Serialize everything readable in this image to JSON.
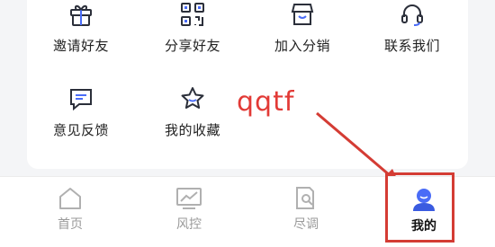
{
  "grid": {
    "items": [
      {
        "label": "邀请好友",
        "icon": "gift-icon"
      },
      {
        "label": "分享好友",
        "icon": "qr-code-icon"
      },
      {
        "label": "加入分销",
        "icon": "store-icon"
      },
      {
        "label": "联系我们",
        "icon": "headset-icon"
      },
      {
        "label": "意见反馈",
        "icon": "feedback-icon"
      },
      {
        "label": "我的收藏",
        "icon": "star-icon"
      }
    ]
  },
  "annotation": {
    "text": "qqtf",
    "color": "#e23a36"
  },
  "tabbar": {
    "tabs": [
      {
        "label": "首页",
        "icon": "home-icon",
        "active": false
      },
      {
        "label": "风控",
        "icon": "risk-chart-icon",
        "active": false
      },
      {
        "label": "尽调",
        "icon": "document-search-icon",
        "active": false
      },
      {
        "label": "我的",
        "icon": "user-icon",
        "active": true
      }
    ]
  },
  "colors": {
    "accent": "#4a6cf7",
    "annotation": "#d43c34",
    "text": "#222222",
    "inactive": "#9a9a9a"
  }
}
